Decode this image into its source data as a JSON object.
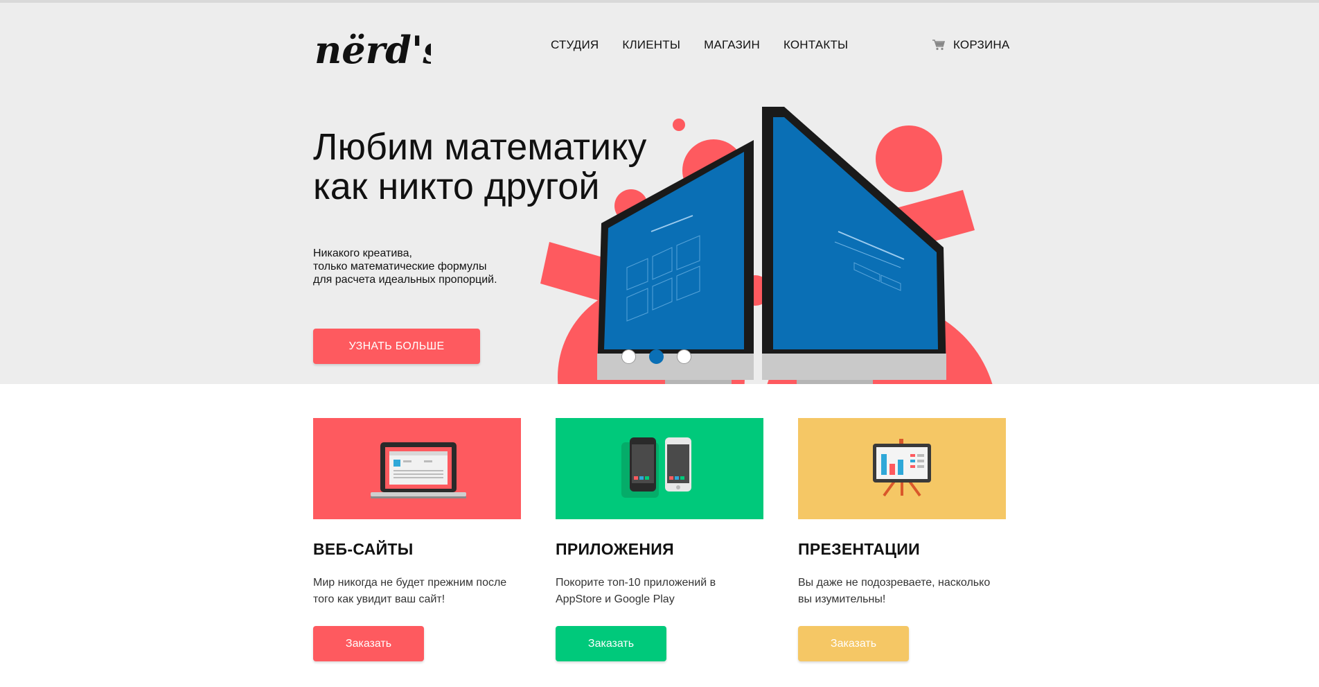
{
  "header": {
    "logo_text": "nërd's",
    "nav": [
      "СТУДИЯ",
      "КЛИЕНТЫ",
      "МАГАЗИН",
      "КОНТАКТЫ"
    ],
    "cart_label": "КОРЗИНА",
    "cart_icon": "cart-icon"
  },
  "hero": {
    "title_lines": [
      "Любим математику",
      "как никто другой"
    ],
    "text_lines": [
      "Никакого креатива,",
      "только математические формулы",
      "для расчета идеальных пропорций."
    ],
    "button_label": "УЗНАТЬ БОЛЬШЕ",
    "slider_active": 2,
    "slider_count": 3,
    "colors": {
      "accent": "#fe5a5f",
      "screen": "#0a6fb5",
      "background": "#ededed"
    }
  },
  "services": [
    {
      "title": "ВЕБ-САЙТЫ",
      "text_lines": [
        "Мир никогда не будет прежним после",
        "того как увидит ваш сайт!"
      ],
      "button_label": "Заказать",
      "color": "#fe5a5f",
      "icon": "laptop-icon"
    },
    {
      "title": "ПРИЛОЖЕНИЯ",
      "text_lines": [
        "Покорите топ-10 приложений в",
        "AppStore и Google Play"
      ],
      "button_label": "Заказать",
      "color": "#00c97b",
      "icon": "smartphones-icon"
    },
    {
      "title": "ПРЕЗЕНТАЦИИ",
      "text_lines": [
        "Вы даже не подозреваете, насколько",
        "вы изумительны!"
      ],
      "button_label": "Заказать",
      "color": "#f5c765",
      "icon": "presentation-board-icon"
    }
  ]
}
